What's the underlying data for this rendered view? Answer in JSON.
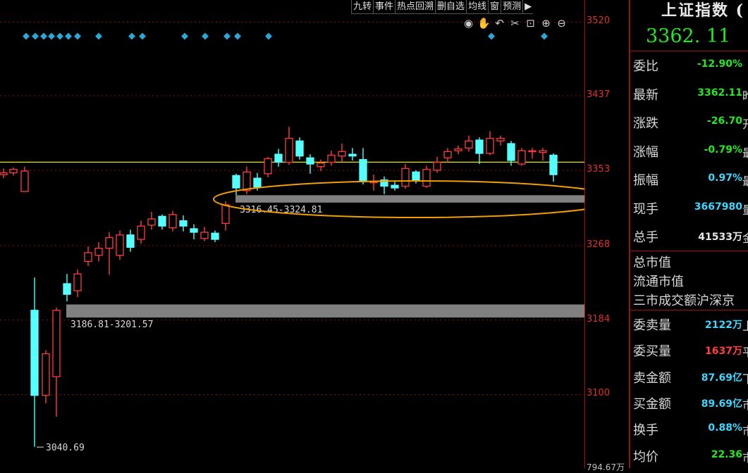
{
  "toolbar": {
    "items": [
      "九转",
      "事件",
      "热点回溯",
      "删自选",
      "均线",
      "窗",
      "预测",
      "▶"
    ]
  },
  "tools": {
    "items": [
      {
        "name": "eye-icon",
        "glyph": "◉"
      },
      {
        "name": "hand-icon",
        "glyph": "✋"
      },
      {
        "name": "undo-icon",
        "glyph": "↶"
      },
      {
        "name": "scissors-icon",
        "glyph": "✂"
      },
      {
        "name": "lock-icon",
        "glyph": "⊡"
      },
      {
        "name": "zoom-in-icon",
        "glyph": "⊕"
      },
      {
        "name": "zoom-out-icon",
        "glyph": "⊖"
      }
    ]
  },
  "chart_data": {
    "type": "candlestick",
    "ylim": [
      3017,
      3545
    ],
    "y_ticks": [
      "3520",
      "3437",
      "3353",
      "3268",
      "3184",
      "3100"
    ],
    "volume_label": "794.67万",
    "current_line": 3362.11,
    "colors": {
      "up": "#ff3c3c",
      "down": "#54ffff",
      "line": "#e8e800",
      "zone": "#808080",
      "ellipse": "#f0a000",
      "marker": "#2aa8d8"
    },
    "zones": [
      {
        "low": 3316.45,
        "high": 3324.81,
        "label": "3316.45-3324.81"
      },
      {
        "low": 3186.81,
        "high": 3201.57,
        "label": "3186.81-3201.57"
      }
    ],
    "low_annotation": {
      "value": 3040.69,
      "label": "3040.69"
    },
    "event_markers": [
      37,
      50,
      62,
      73,
      85,
      97,
      110,
      140,
      187,
      202,
      262,
      291,
      322,
      337,
      381,
      697,
      772
    ],
    "candles": [
      {
        "x": 5,
        "o": 3348,
        "c": 3350,
        "h": 3355,
        "l": 3344
      },
      {
        "x": 19,
        "o": 3350,
        "c": 3354,
        "h": 3356,
        "l": 3347
      },
      {
        "x": 35,
        "o": 3329,
        "c": 3352,
        "h": 3357,
        "l": 3329
      },
      {
        "x": 49,
        "o": 3195,
        "c": 3099,
        "h": 3232,
        "l": 3041
      },
      {
        "x": 65,
        "o": 3099,
        "c": 3146,
        "h": 3150,
        "l": 3090
      },
      {
        "x": 80,
        "o": 3120,
        "c": 3195,
        "h": 3198,
        "l": 3075
      },
      {
        "x": 95,
        "o": 3225,
        "c": 3213,
        "h": 3236,
        "l": 3205
      },
      {
        "x": 110,
        "o": 3217,
        "c": 3236,
        "h": 3241,
        "l": 3210
      },
      {
        "x": 125,
        "o": 3250,
        "c": 3260,
        "h": 3267,
        "l": 3245
      },
      {
        "x": 140,
        "o": 3257,
        "c": 3265,
        "h": 3272,
        "l": 3250
      },
      {
        "x": 155,
        "o": 3265,
        "c": 3277,
        "h": 3283,
        "l": 3235
      },
      {
        "x": 170,
        "o": 3257,
        "c": 3280,
        "h": 3285,
        "l": 3252
      },
      {
        "x": 185,
        "o": 3280,
        "c": 3266,
        "h": 3286,
        "l": 3261
      },
      {
        "x": 200,
        "o": 3275,
        "c": 3290,
        "h": 3296,
        "l": 3270
      },
      {
        "x": 215,
        "o": 3291,
        "c": 3298,
        "h": 3306,
        "l": 3286
      },
      {
        "x": 230,
        "o": 3301,
        "c": 3290,
        "h": 3303,
        "l": 3286
      },
      {
        "x": 245,
        "o": 3288,
        "c": 3303,
        "h": 3307,
        "l": 3284
      },
      {
        "x": 260,
        "o": 3296,
        "c": 3290,
        "h": 3302,
        "l": 3284
      },
      {
        "x": 275,
        "o": 3287,
        "c": 3283,
        "h": 3292,
        "l": 3275
      },
      {
        "x": 290,
        "o": 3276,
        "c": 3283,
        "h": 3289,
        "l": 3273
      },
      {
        "x": 305,
        "o": 3282,
        "c": 3275,
        "h": 3285,
        "l": 3272
      },
      {
        "x": 320,
        "o": 3293,
        "c": 3314,
        "h": 3318,
        "l": 3285
      },
      {
        "x": 335,
        "o": 3347,
        "c": 3333,
        "h": 3349,
        "l": 3325
      },
      {
        "x": 350,
        "o": 3330,
        "c": 3351,
        "h": 3357,
        "l": 3326
      },
      {
        "x": 365,
        "o": 3344,
        "c": 3334,
        "h": 3350,
        "l": 3330
      },
      {
        "x": 380,
        "o": 3349,
        "c": 3366,
        "h": 3368,
        "l": 3345
      },
      {
        "x": 395,
        "o": 3371,
        "c": 3362,
        "h": 3377,
        "l": 3357
      },
      {
        "x": 410,
        "o": 3362,
        "c": 3389,
        "h": 3402,
        "l": 3359
      },
      {
        "x": 425,
        "o": 3386,
        "c": 3369,
        "h": 3390,
        "l": 3365
      },
      {
        "x": 440,
        "o": 3367,
        "c": 3360,
        "h": 3371,
        "l": 3349
      },
      {
        "x": 455,
        "o": 3357,
        "c": 3361,
        "h": 3365,
        "l": 3352
      },
      {
        "x": 470,
        "o": 3362,
        "c": 3370,
        "h": 3375,
        "l": 3358
      },
      {
        "x": 485,
        "o": 3369,
        "c": 3374,
        "h": 3383,
        "l": 3362
      },
      {
        "x": 500,
        "o": 3371,
        "c": 3369,
        "h": 3378,
        "l": 3364
      },
      {
        "x": 515,
        "o": 3365,
        "c": 3340,
        "h": 3378,
        "l": 3337
      },
      {
        "x": 530,
        "o": 3340,
        "c": 3340,
        "h": 3348,
        "l": 3330
      },
      {
        "x": 545,
        "o": 3342,
        "c": 3335,
        "h": 3346,
        "l": 3326
      },
      {
        "x": 560,
        "o": 3336,
        "c": 3333,
        "h": 3340,
        "l": 3330
      },
      {
        "x": 575,
        "o": 3335,
        "c": 3355,
        "h": 3360,
        "l": 3332
      },
      {
        "x": 590,
        "o": 3351,
        "c": 3342,
        "h": 3353,
        "l": 3338
      },
      {
        "x": 605,
        "o": 3335,
        "c": 3354,
        "h": 3358,
        "l": 3333
      },
      {
        "x": 620,
        "o": 3353,
        "c": 3362,
        "h": 3368,
        "l": 3350
      },
      {
        "x": 635,
        "o": 3367,
        "c": 3374,
        "h": 3378,
        "l": 3362
      },
      {
        "x": 650,
        "o": 3375,
        "c": 3377,
        "h": 3381,
        "l": 3371
      },
      {
        "x": 665,
        "o": 3378,
        "c": 3386,
        "h": 3392,
        "l": 3374
      },
      {
        "x": 680,
        "o": 3387,
        "c": 3372,
        "h": 3390,
        "l": 3360
      },
      {
        "x": 695,
        "o": 3372,
        "c": 3389,
        "h": 3397,
        "l": 3370
      },
      {
        "x": 710,
        "o": 3386,
        "c": 3389,
        "h": 3392,
        "l": 3381
      },
      {
        "x": 725,
        "o": 3383,
        "c": 3364,
        "h": 3386,
        "l": 3358
      },
      {
        "x": 740,
        "o": 3360,
        "c": 3375,
        "h": 3378,
        "l": 3358
      },
      {
        "x": 755,
        "o": 3375,
        "c": 3375,
        "h": 3378,
        "l": 3366
      },
      {
        "x": 770,
        "o": 3373,
        "c": 3375,
        "h": 3378,
        "l": 3364
      },
      {
        "x": 785,
        "o": 3370,
        "c": 3348,
        "h": 3372,
        "l": 3340
      }
    ]
  },
  "panel": {
    "title": "上证指数 (",
    "price": "3362. 11",
    "rows_top": [
      {
        "label": "委比",
        "value": "-12.90%",
        "color": "#22e822",
        "tail": ""
      },
      {
        "label": "最新",
        "value": "3362.11",
        "color": "#22e822",
        "tail": "昨"
      },
      {
        "label": "涨跌",
        "value": "-26.70",
        "color": "#22e822",
        "tail": "开"
      },
      {
        "label": "涨幅",
        "value": "-0.79%",
        "color": "#22e822",
        "tail": "最"
      },
      {
        "label": "振幅",
        "value": "0.97%",
        "color": "#3cd8ff",
        "tail": "最"
      },
      {
        "label": "现手",
        "value": "3667980",
        "color": "#3cd8ff",
        "tail": "量"
      },
      {
        "label": "总手",
        "value": "41533万",
        "color": "#e8e8e8",
        "tail": "金"
      }
    ],
    "plain_rows": [
      "总市值",
      "流通市值",
      "三市成交额沪深京"
    ],
    "rows_bottom": [
      {
        "label": "委卖量",
        "value": "2122万",
        "color": "#3cd8ff",
        "tail": "上"
      },
      {
        "label": "委买量",
        "value": "1637万",
        "color": "#ff4040",
        "tail": "平"
      },
      {
        "label": "卖金额",
        "value": "87.69亿",
        "color": "#3cd8ff",
        "tail": "下"
      },
      {
        "label": "买金额",
        "value": "89.69亿",
        "color": "#3cd8ff",
        "tail": "市"
      },
      {
        "label": "换手",
        "value": "0.88%",
        "color": "#3cd8ff",
        "tail": "市"
      },
      {
        "label": "均价",
        "value": "22.36",
        "color": "#22e822",
        "tail": "市"
      }
    ]
  }
}
